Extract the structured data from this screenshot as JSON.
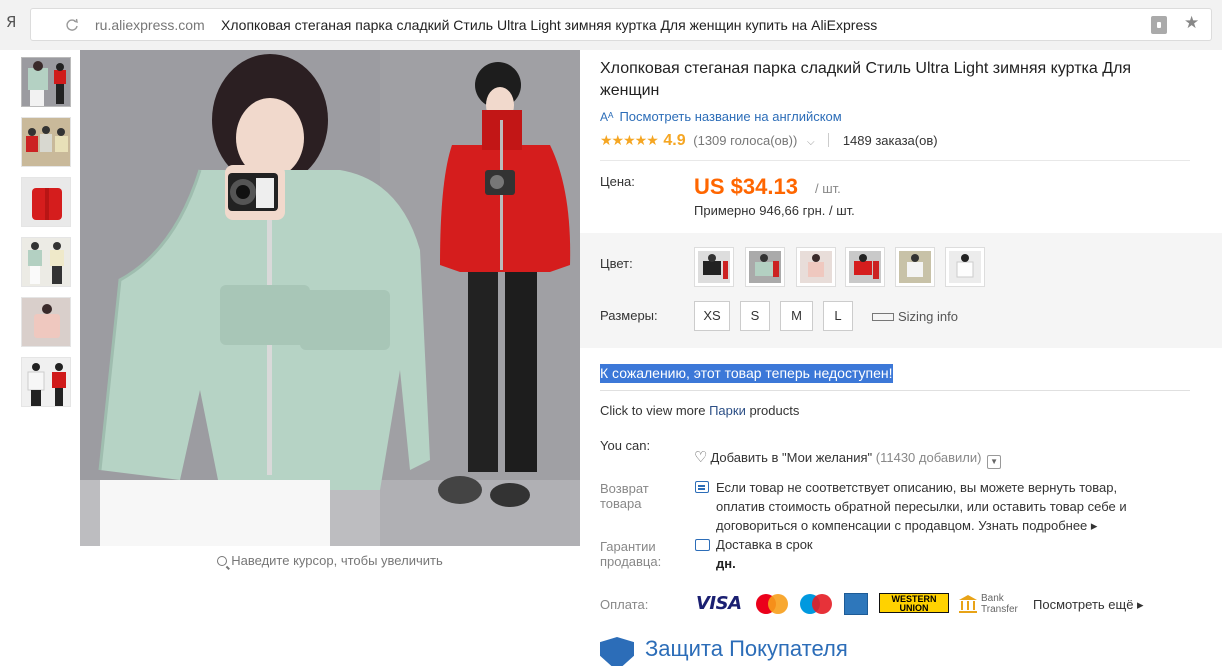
{
  "browser": {
    "logo": "Я",
    "url_host": "ru.aliexpress.com",
    "page_title": "Хлопковая стеганая парка сладкий Стиль Ultra Light зимняя куртка Для женщин купить на AliExpress"
  },
  "gallery": {
    "thumbnails": [
      "mint-jacket-pair",
      "group-photo",
      "red-jacket",
      "studio-pair",
      "pink-jacket",
      "white-jacket"
    ],
    "zoom_hint": "Наведите курсор, чтобы увеличить"
  },
  "product": {
    "title": "Хлопковая стеганая парка сладкий Стиль Ultra Light зимняя куртка Для женщин",
    "translate_icon": "А",
    "translate_link": "Посмотреть название на английском",
    "rating_stars": "★★★★★",
    "rating": "4.9",
    "votes": "(1309 голоса(ов))",
    "orders": "1489 заказа(ов)",
    "price_label": "Цена:",
    "price": "US $34.13",
    "unit": "/ шт.",
    "approx_price": "Примерно 946,66 грн. / шт.",
    "color_label": "Цвет:",
    "colors": [
      "black",
      "mint",
      "pink",
      "red",
      "white",
      "light-gray"
    ],
    "size_label": "Размеры:",
    "sizes": [
      "XS",
      "S",
      "M",
      "L"
    ],
    "sizing_info": "Sizing info",
    "unavailable": "К сожалению, этот товар теперь недоступен!",
    "more_prefix": "Click to view more ",
    "more_link": "Парки",
    "more_suffix": " products",
    "you_can_label": "You can:",
    "wishlist_text": "Добавить в \"Мои желания\"",
    "wishlist_count": "(11430 добавили)",
    "return_label_1": "Возврат",
    "return_label_2": "товара",
    "return_text": "Если товар не соответствует описанию, вы можете вернуть товар, оплатив стоимость обратной пересылки, или оставить товар себе и договориться о компенсации с продавцом.",
    "return_more": "Узнать подробнее ▸",
    "guarantee_label_1": "Гарантии",
    "guarantee_label_2": "продавца:",
    "delivery_text": "Доставка в срок",
    "delivery_sub": "дн.",
    "payment_label": "Оплата:",
    "payment_methods": [
      "VISA",
      "MasterCard",
      "Maestro",
      "American Express",
      "WESTERN UNION",
      "Bank Transfer"
    ],
    "visa": "VISA",
    "wu_line1": "WESTERN",
    "wu_line2": "UNION",
    "bank_line1": "Bank",
    "bank_line2": "Transfer",
    "see_more": "Посмотреть ещё ▸",
    "protection": "Защита Покупателя"
  },
  "colors": {
    "price": "#ff6600",
    "link": "#2c6db8",
    "star": "#f5a623",
    "highlight": "#3c78d8"
  }
}
